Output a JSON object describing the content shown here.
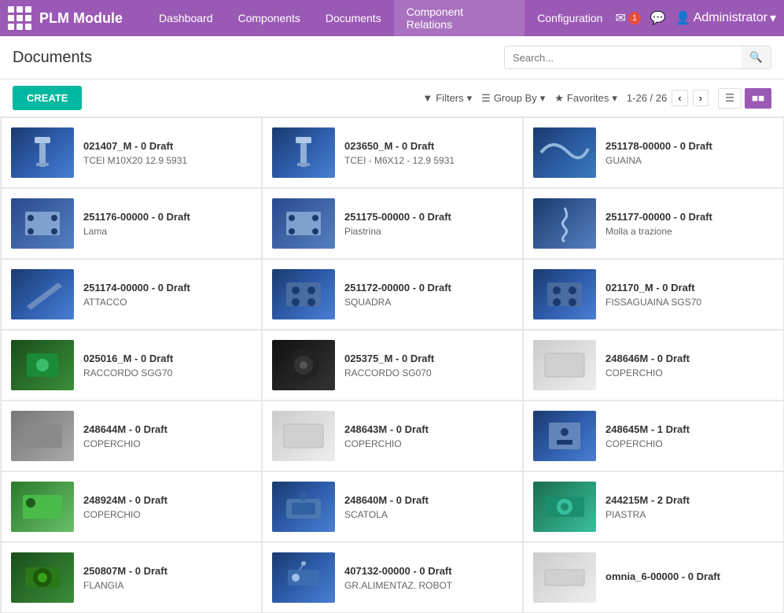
{
  "app": {
    "logo": "PLM Module",
    "nav_items": [
      {
        "label": "Dashboard",
        "active": false
      },
      {
        "label": "Components",
        "active": false
      },
      {
        "label": "Documents",
        "active": false
      },
      {
        "label": "Component Relations",
        "active": true
      },
      {
        "label": "Configuration",
        "active": false
      }
    ],
    "notification_count": "1",
    "user": "Administrator"
  },
  "page": {
    "title": "Documents"
  },
  "search": {
    "placeholder": "Search..."
  },
  "toolbar": {
    "create_label": "CREATE",
    "filters_label": "Filters",
    "group_by_label": "Group By",
    "favorites_label": "Favorites",
    "pager": "1-26 / 26"
  },
  "documents": [
    {
      "id": "021407_M - 0 Draft",
      "sub": "TCEI M10X20 12.9 5931",
      "thumb": "blue"
    },
    {
      "id": "023650_M - 0 Draft",
      "sub": "TCEI - M6X12 - 12.9 5931",
      "thumb": "blue"
    },
    {
      "id": "251178-00000 - 0 Draft",
      "sub": "GUAINA",
      "thumb": "wire"
    },
    {
      "id": "251176-00000 - 0 Draft",
      "sub": "Lama",
      "thumb": "plate"
    },
    {
      "id": "251175-00000 - 0 Draft",
      "sub": "Piastrina",
      "thumb": "plate"
    },
    {
      "id": "251177-00000 - 0 Draft",
      "sub": "Molla a trazione",
      "thumb": "spring"
    },
    {
      "id": "251174-00000 - 0 Draft",
      "sub": "ATTACCO",
      "thumb": "blue"
    },
    {
      "id": "251172-00000 - 0 Draft",
      "sub": "SQUADRA",
      "thumb": "blue"
    },
    {
      "id": "021170_M - 0 Draft",
      "sub": "FISSAGUAINA SGS70",
      "thumb": "blue"
    },
    {
      "id": "025016_M - 0 Draft",
      "sub": "RACCORDO SGG70",
      "thumb": "green"
    },
    {
      "id": "025375_M - 0 Draft",
      "sub": "RACCORDO SG070",
      "thumb": "dark"
    },
    {
      "id": "248646M - 0 Draft",
      "sub": "COPERCHIO",
      "thumb": "white"
    },
    {
      "id": "248644M - 0 Draft",
      "sub": "COPERCHIO",
      "thumb": "gray"
    },
    {
      "id": "248643M - 0 Draft",
      "sub": "COPERCHIO",
      "thumb": "white"
    },
    {
      "id": "248645M - 1 Draft",
      "sub": "COPERCHIO",
      "thumb": "blue"
    },
    {
      "id": "248924M - 0 Draft",
      "sub": "COPERCHIO",
      "thumb": "lightgreen"
    },
    {
      "id": "248640M - 0 Draft",
      "sub": "SCATOLA",
      "thumb": "blue"
    },
    {
      "id": "244215M - 2 Draft",
      "sub": "PIASTRA",
      "thumb": "teal"
    },
    {
      "id": "250807M - 0 Draft",
      "sub": "FLANGIA",
      "thumb": "green"
    },
    {
      "id": "407132-00000 - 0 Draft",
      "sub": "GR.ALIMENTAZ. ROBOT",
      "thumb": "blue"
    },
    {
      "id": "omnia_6-00000 - 0 Draft",
      "sub": "",
      "thumb": "white"
    }
  ]
}
